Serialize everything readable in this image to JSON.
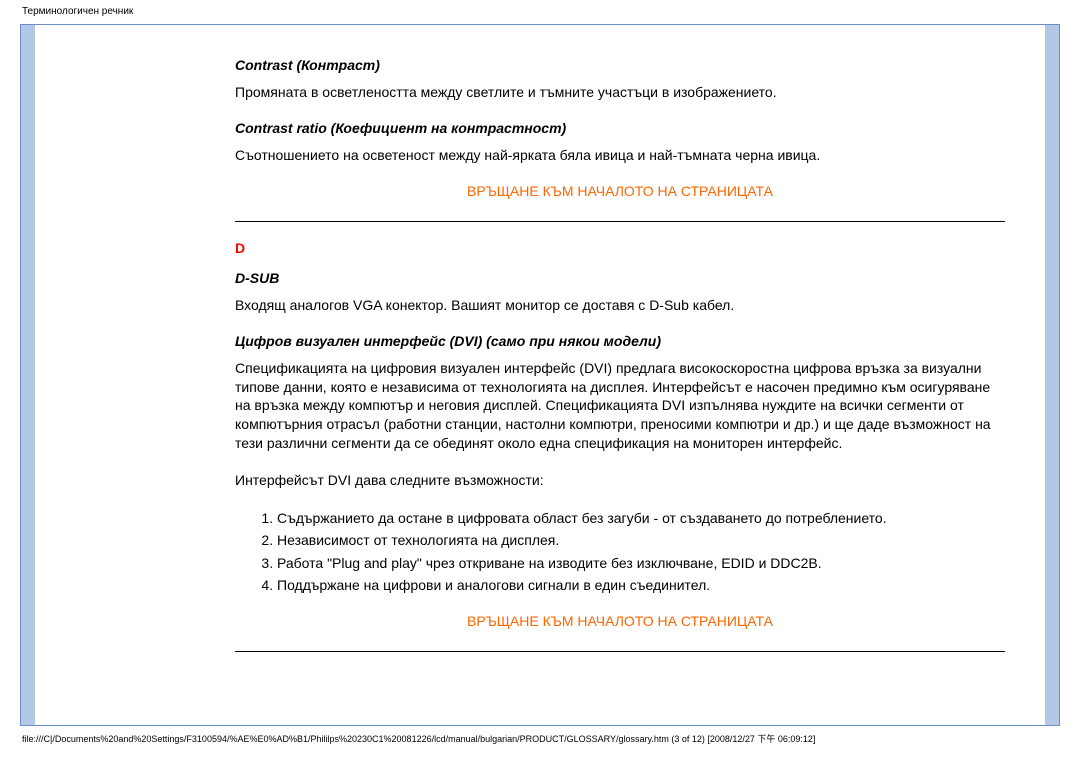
{
  "header": {
    "title": "Терминологичен речник"
  },
  "content": {
    "contrast": {
      "heading": "Contrast (Контраст)",
      "text": "Промяната в осветлеността между светлите и тъмните участъци в изображението."
    },
    "contrast_ratio": {
      "heading": "Contrast ratio (Коефициент на контрастност)",
      "text": "Съотношението на осветеност между най-ярката бяла ивица и най-тъмната черна ивица."
    },
    "top_link_1": "ВРЪЩАНЕ КЪМ НАЧАЛОТО НА СТРАНИЦАТА",
    "letter_d": "D",
    "dsub": {
      "heading": "D-SUB",
      "text": "Входящ аналогов VGA конектор. Вашият монитор се доставя с D-Sub кабел."
    },
    "dvi": {
      "heading": "Цифров визуален интерфейс (DVI) (само при някои модели)",
      "para1": "Спецификацията на цифровия визуален интерфейс (DVI) предлага високоскоростна цифрова връзка за визуални типове данни, която е независима от технологията на дисплея. Интерфейсът е насочен предимно към осигуряване на връзка между компютър и неговия дисплей. Спецификацията DVI изпълнява нуждите на всички сегменти от компютърния отрасъл (работни станции, настолни компютри, преносими компютри и др.) и ще даде възможност на тези различни сегменти да се обединят около една спецификация на мониторен интерфейс.",
      "para2": "Интерфейсът DVI дава следните възможности:",
      "list": [
        "Съдържанието да остане в цифровата област без загуби - от създаването до потреблението.",
        "Независимост от технологията на дисплея.",
        "Работа \"Plug and play\" чрез откриване на изводите без изключване, EDID и DDC2B.",
        "Поддържане на цифрови и аналогови сигнали в един съединител."
      ]
    },
    "top_link_2": "ВРЪЩАНЕ КЪМ НАЧАЛОТО НА СТРАНИЦАТА"
  },
  "footer": {
    "path": "file:///C|/Documents%20and%20Settings/F3100594/%AE%E0%AD%B1/Phililps%20230C1%20081226/lcd/manual/bulgarian/PRODUCT/GLOSSARY/glossary.htm (3 of 12) [2008/12/27 下午 06:09:12]"
  }
}
